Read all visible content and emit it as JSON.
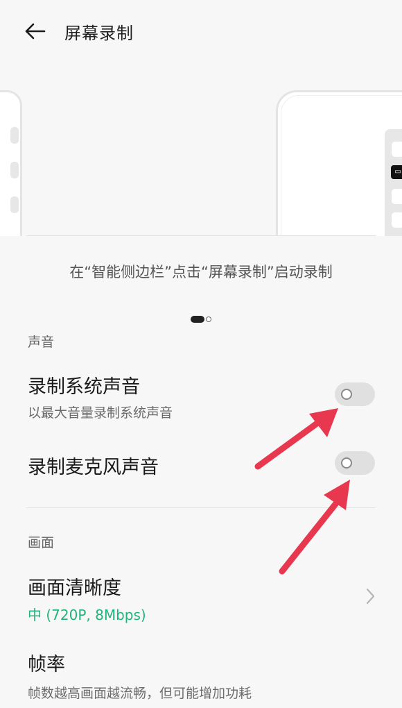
{
  "header": {
    "title": "屏幕录制"
  },
  "preview": {
    "caption": "在“智能侧边栏”点击“屏幕录制”启动录制"
  },
  "sections": {
    "sound": {
      "label": "声音",
      "system_audio": {
        "title": "录制系统声音",
        "subtitle": "以最大音量录制系统声音",
        "enabled": false
      },
      "mic_audio": {
        "title": "录制麦克风声音",
        "enabled": false
      }
    },
    "video": {
      "label": "画面",
      "resolution": {
        "title": "画面清晰度",
        "value": "中 (720P, 8Mbps)"
      },
      "frame_rate": {
        "title": "帧率",
        "subtitle": "帧数越高画面越流畅，但可能增加功耗"
      }
    }
  },
  "colors": {
    "accent": "#1fb57a",
    "annotation_arrow": "#e8384f",
    "toggle_off": "#e0e0e0"
  },
  "icons": {
    "back": "arrow-left-icon",
    "chevron": "chevron-right-icon",
    "record": "screen-record-icon"
  }
}
